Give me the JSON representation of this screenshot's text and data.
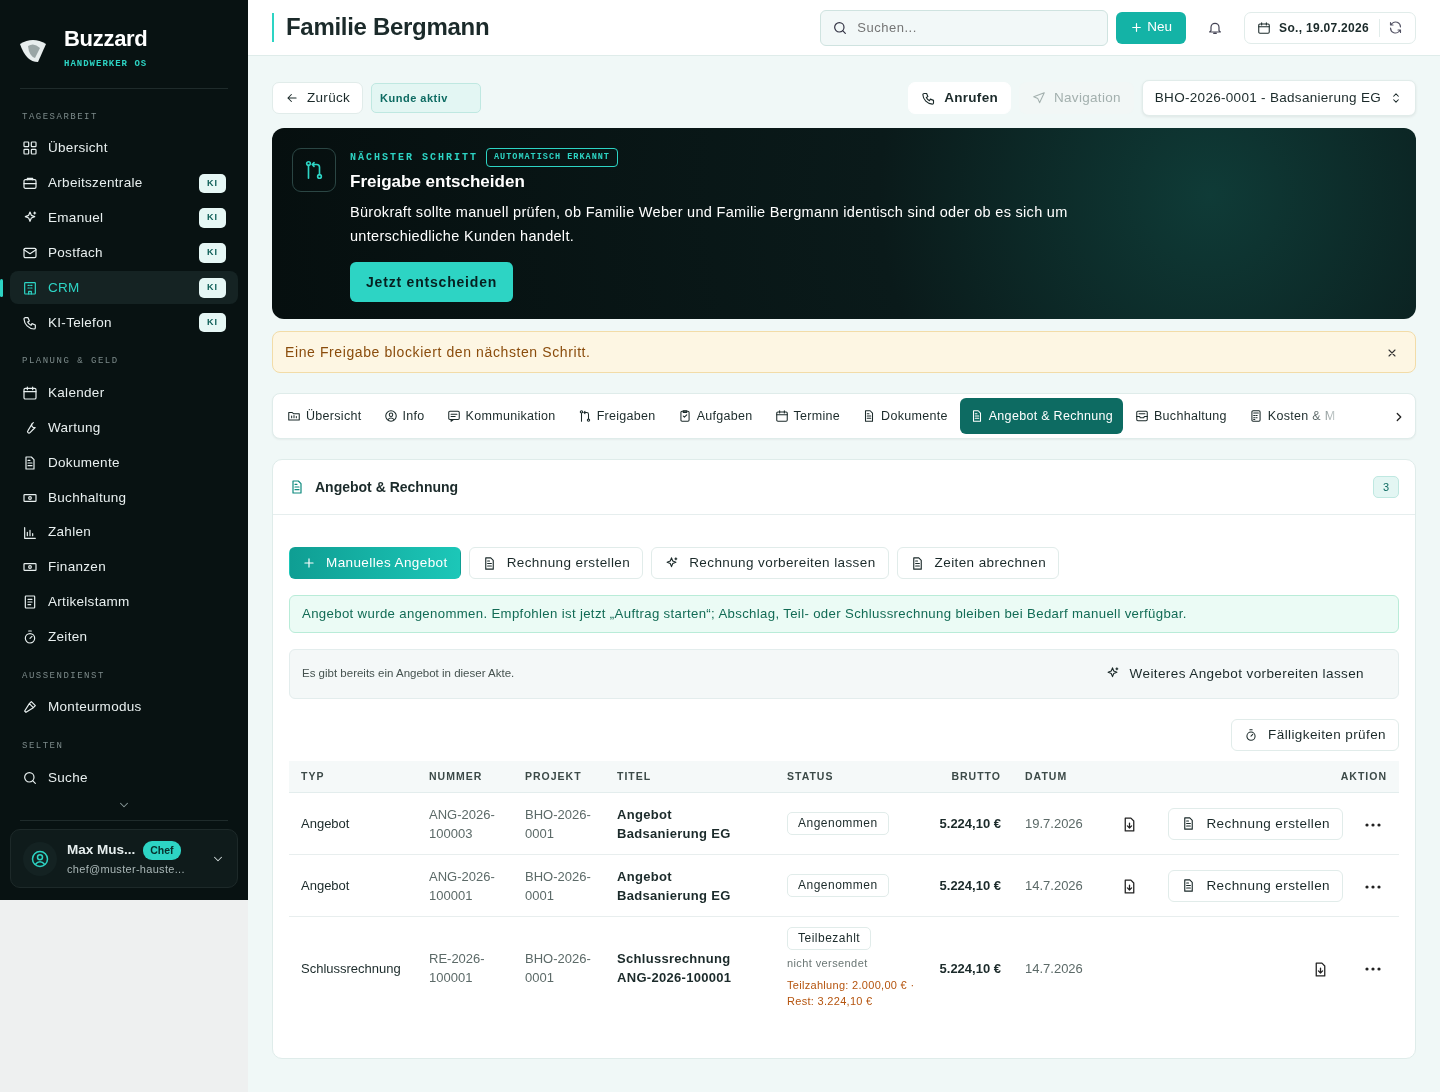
{
  "brand": {
    "name": "Buzzard",
    "tagline": "HANDWERKER OS"
  },
  "sidebar": {
    "sections": [
      {
        "heading": "TAGESARBEIT",
        "items": [
          {
            "label": "Übersicht",
            "selected": false
          },
          {
            "label": "Arbeitszentrale",
            "badge": "KI",
            "selected": false
          },
          {
            "label": "Emanuel",
            "badge": "KI",
            "selected": false
          },
          {
            "label": "Postfach",
            "badge": "KI",
            "selected": false
          },
          {
            "label": "CRM",
            "badge": "KI",
            "selected": true
          },
          {
            "label": "KI-Telefon",
            "badge": "KI",
            "selected": false
          }
        ]
      },
      {
        "heading": "PLANUNG & GELD",
        "items": [
          {
            "label": "Kalender",
            "selected": false
          },
          {
            "label": "Wartung",
            "selected": false
          },
          {
            "label": "Dokumente",
            "selected": false
          },
          {
            "label": "Buchhaltung",
            "selected": false
          },
          {
            "label": "Zahlen",
            "selected": false
          },
          {
            "label": "Finanzen",
            "selected": false
          },
          {
            "label": "Artikelstamm",
            "selected": false
          },
          {
            "label": "Zeiten",
            "selected": false
          }
        ]
      },
      {
        "heading": "AUSSENDIENST",
        "items": [
          {
            "label": "Monteurmodus",
            "selected": false
          }
        ]
      },
      {
        "heading": "SELTEN",
        "items": [
          {
            "label": "Suche",
            "selected": false
          }
        ]
      }
    ]
  },
  "user": {
    "name": "Max Mus...",
    "role": "Chef",
    "email": "chef@muster-hauste..."
  },
  "header": {
    "title": "Familie Bergmann",
    "search_placeholder": "Suchen...",
    "new_button": "Neu",
    "date": "So., 19.07.2026"
  },
  "toolbar": {
    "back": "Zurück",
    "status": "Kunde aktiv",
    "call": "Anrufen",
    "navigation": {
      "label": "Navigation",
      "disabled": true
    },
    "project": "BHO-2026-0001 - Badsanierung EG"
  },
  "next_step": {
    "eyebrow": "NÄCHSTER SCHRITT",
    "tag": "AUTOMATISCH ERKANNT",
    "title": "Freigabe entscheiden",
    "text": "Bürokraft sollte manuell prüfen, ob Familie Weber und Familie Bergmann identisch sind oder ob es sich um unterschiedliche Kunden handelt.",
    "button": "Jetzt entscheiden"
  },
  "alert": {
    "text": "Eine Freigabe blockiert den nächsten Schritt."
  },
  "tabs": [
    {
      "label": "Übersicht",
      "selected": false
    },
    {
      "label": "Info",
      "selected": false
    },
    {
      "label": "Kommunikation",
      "selected": false
    },
    {
      "label": "Freigaben",
      "selected": false
    },
    {
      "label": "Aufgaben",
      "selected": false
    },
    {
      "label": "Termine",
      "selected": false
    },
    {
      "label": "Dokumente",
      "selected": false
    },
    {
      "label": "Angebot & Rechnung",
      "selected": true
    },
    {
      "label": "Buchhaltung",
      "selected": false
    },
    {
      "label": "Kosten & M",
      "selected": false
    }
  ],
  "panel": {
    "title": "Angebot & Rechnung",
    "count": "3",
    "actions": [
      {
        "label": "Manuelles Angebot",
        "kind": "primary"
      },
      {
        "label": "Rechnung erstellen",
        "kind": "doc"
      },
      {
        "label": "Rechnung vorbereiten lassen",
        "kind": "ai"
      },
      {
        "label": "Zeiten abrechnen",
        "kind": "doc"
      }
    ],
    "success_note": "Angebot wurde angenommen. Empfohlen ist jetzt „Auftrag starten“; Abschlag, Teil- oder Schlussrechnung bleiben bei Bedarf manuell verfügbar.",
    "info": {
      "text": "Es gibt bereits ein Angebot in dieser Akte.",
      "button": "Weiteres Angebot vorbereiten lassen"
    },
    "due_button": "Fälligkeiten prüfen",
    "table": {
      "columns": [
        "TYP",
        "NUMMER",
        "PROJEKT",
        "TITEL",
        "STATUS",
        "BRUTTO",
        "DATUM",
        "AKTION"
      ],
      "rows": [
        {
          "type": "Angebot",
          "number": "ANG-2026-100003",
          "project": "BHO-2026-0001",
          "title": "Angebot Badsanierung EG",
          "status": "Angenommen",
          "amount": "5.224,10 €",
          "date": "19.7.2026",
          "action": "Rechnung erstellen"
        },
        {
          "type": "Angebot",
          "number": "ANG-2026-100001",
          "project": "BHO-2026-0001",
          "title": "Angebot Badsanierung EG",
          "status": "Angenommen",
          "amount": "5.224,10 €",
          "date": "14.7.2026",
          "action": "Rechnung erstellen"
        },
        {
          "type": "Schlussrechnung",
          "number": "RE-2026-100001",
          "project": "BHO-2026-0001",
          "title": "Schlussrechnung ANG-2026-100001",
          "status": "Teilbezahlt",
          "note": "nicht versendet",
          "payment": "Teilzahlung: 2.000,00 € · Rest: 3.224,10 €",
          "amount": "5.224,10 €",
          "date": "14.7.2026"
        }
      ]
    }
  }
}
